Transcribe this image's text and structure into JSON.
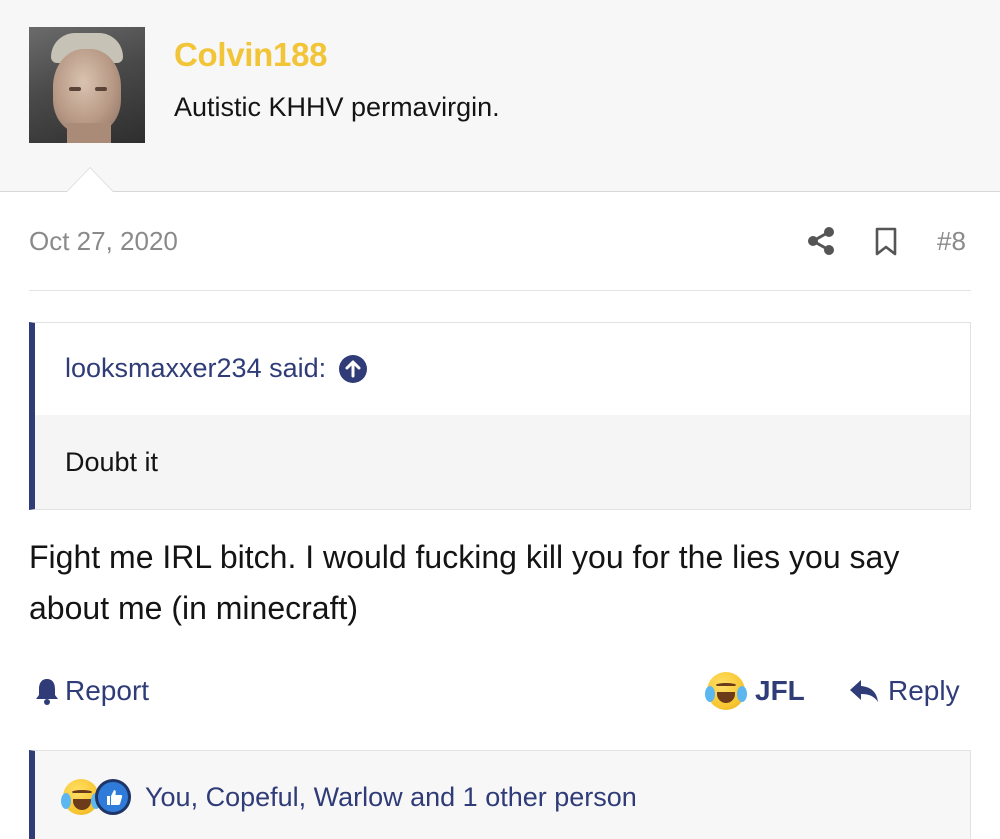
{
  "user": {
    "username": "Colvin188",
    "title": "Autistic KHHV permavirgin."
  },
  "post": {
    "date": "Oct 27, 2020",
    "number": "#8"
  },
  "quote": {
    "author_label": "looksmaxxer234 said:",
    "text": "Doubt it"
  },
  "message": {
    "text": "Fight me IRL bitch. I would fucking kill you for the lies you say about me (in minecraft)"
  },
  "actions": {
    "report_label": "Report",
    "reaction_label": "JFL",
    "reply_label": "Reply"
  },
  "reactions": {
    "summary": "You, Copeful, Warlow and 1 other person"
  },
  "colors": {
    "username": "#f2c437",
    "accent": "#2f3c78",
    "muted": "#8a8a8a"
  }
}
